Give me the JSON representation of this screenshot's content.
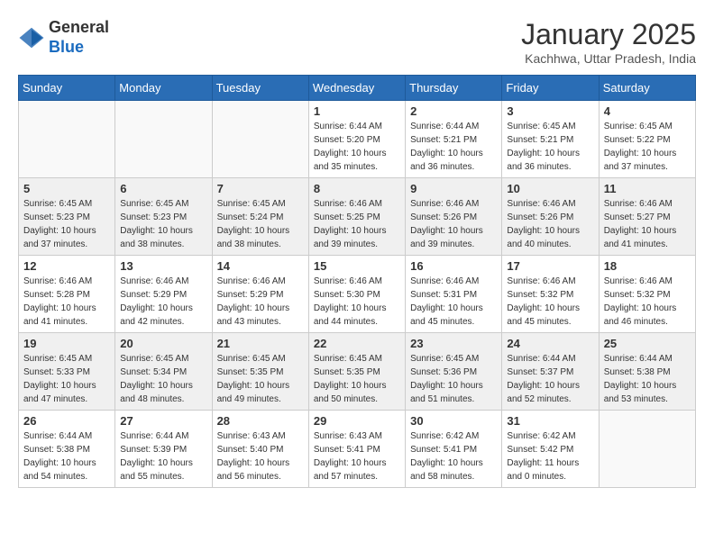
{
  "header": {
    "logo_general": "General",
    "logo_blue": "Blue",
    "month_title": "January 2025",
    "location": "Kachhwa, Uttar Pradesh, India"
  },
  "weekdays": [
    "Sunday",
    "Monday",
    "Tuesday",
    "Wednesday",
    "Thursday",
    "Friday",
    "Saturday"
  ],
  "weeks": [
    [
      {
        "day": "",
        "info": ""
      },
      {
        "day": "",
        "info": ""
      },
      {
        "day": "",
        "info": ""
      },
      {
        "day": "1",
        "info": "Sunrise: 6:44 AM\nSunset: 5:20 PM\nDaylight: 10 hours\nand 35 minutes."
      },
      {
        "day": "2",
        "info": "Sunrise: 6:44 AM\nSunset: 5:21 PM\nDaylight: 10 hours\nand 36 minutes."
      },
      {
        "day": "3",
        "info": "Sunrise: 6:45 AM\nSunset: 5:21 PM\nDaylight: 10 hours\nand 36 minutes."
      },
      {
        "day": "4",
        "info": "Sunrise: 6:45 AM\nSunset: 5:22 PM\nDaylight: 10 hours\nand 37 minutes."
      }
    ],
    [
      {
        "day": "5",
        "info": "Sunrise: 6:45 AM\nSunset: 5:23 PM\nDaylight: 10 hours\nand 37 minutes."
      },
      {
        "day": "6",
        "info": "Sunrise: 6:45 AM\nSunset: 5:23 PM\nDaylight: 10 hours\nand 38 minutes."
      },
      {
        "day": "7",
        "info": "Sunrise: 6:45 AM\nSunset: 5:24 PM\nDaylight: 10 hours\nand 38 minutes."
      },
      {
        "day": "8",
        "info": "Sunrise: 6:46 AM\nSunset: 5:25 PM\nDaylight: 10 hours\nand 39 minutes."
      },
      {
        "day": "9",
        "info": "Sunrise: 6:46 AM\nSunset: 5:26 PM\nDaylight: 10 hours\nand 39 minutes."
      },
      {
        "day": "10",
        "info": "Sunrise: 6:46 AM\nSunset: 5:26 PM\nDaylight: 10 hours\nand 40 minutes."
      },
      {
        "day": "11",
        "info": "Sunrise: 6:46 AM\nSunset: 5:27 PM\nDaylight: 10 hours\nand 41 minutes."
      }
    ],
    [
      {
        "day": "12",
        "info": "Sunrise: 6:46 AM\nSunset: 5:28 PM\nDaylight: 10 hours\nand 41 minutes."
      },
      {
        "day": "13",
        "info": "Sunrise: 6:46 AM\nSunset: 5:29 PM\nDaylight: 10 hours\nand 42 minutes."
      },
      {
        "day": "14",
        "info": "Sunrise: 6:46 AM\nSunset: 5:29 PM\nDaylight: 10 hours\nand 43 minutes."
      },
      {
        "day": "15",
        "info": "Sunrise: 6:46 AM\nSunset: 5:30 PM\nDaylight: 10 hours\nand 44 minutes."
      },
      {
        "day": "16",
        "info": "Sunrise: 6:46 AM\nSunset: 5:31 PM\nDaylight: 10 hours\nand 45 minutes."
      },
      {
        "day": "17",
        "info": "Sunrise: 6:46 AM\nSunset: 5:32 PM\nDaylight: 10 hours\nand 45 minutes."
      },
      {
        "day": "18",
        "info": "Sunrise: 6:46 AM\nSunset: 5:32 PM\nDaylight: 10 hours\nand 46 minutes."
      }
    ],
    [
      {
        "day": "19",
        "info": "Sunrise: 6:45 AM\nSunset: 5:33 PM\nDaylight: 10 hours\nand 47 minutes."
      },
      {
        "day": "20",
        "info": "Sunrise: 6:45 AM\nSunset: 5:34 PM\nDaylight: 10 hours\nand 48 minutes."
      },
      {
        "day": "21",
        "info": "Sunrise: 6:45 AM\nSunset: 5:35 PM\nDaylight: 10 hours\nand 49 minutes."
      },
      {
        "day": "22",
        "info": "Sunrise: 6:45 AM\nSunset: 5:35 PM\nDaylight: 10 hours\nand 50 minutes."
      },
      {
        "day": "23",
        "info": "Sunrise: 6:45 AM\nSunset: 5:36 PM\nDaylight: 10 hours\nand 51 minutes."
      },
      {
        "day": "24",
        "info": "Sunrise: 6:44 AM\nSunset: 5:37 PM\nDaylight: 10 hours\nand 52 minutes."
      },
      {
        "day": "25",
        "info": "Sunrise: 6:44 AM\nSunset: 5:38 PM\nDaylight: 10 hours\nand 53 minutes."
      }
    ],
    [
      {
        "day": "26",
        "info": "Sunrise: 6:44 AM\nSunset: 5:38 PM\nDaylight: 10 hours\nand 54 minutes."
      },
      {
        "day": "27",
        "info": "Sunrise: 6:44 AM\nSunset: 5:39 PM\nDaylight: 10 hours\nand 55 minutes."
      },
      {
        "day": "28",
        "info": "Sunrise: 6:43 AM\nSunset: 5:40 PM\nDaylight: 10 hours\nand 56 minutes."
      },
      {
        "day": "29",
        "info": "Sunrise: 6:43 AM\nSunset: 5:41 PM\nDaylight: 10 hours\nand 57 minutes."
      },
      {
        "day": "30",
        "info": "Sunrise: 6:42 AM\nSunset: 5:41 PM\nDaylight: 10 hours\nand 58 minutes."
      },
      {
        "day": "31",
        "info": "Sunrise: 6:42 AM\nSunset: 5:42 PM\nDaylight: 11 hours\nand 0 minutes."
      },
      {
        "day": "",
        "info": ""
      }
    ]
  ]
}
